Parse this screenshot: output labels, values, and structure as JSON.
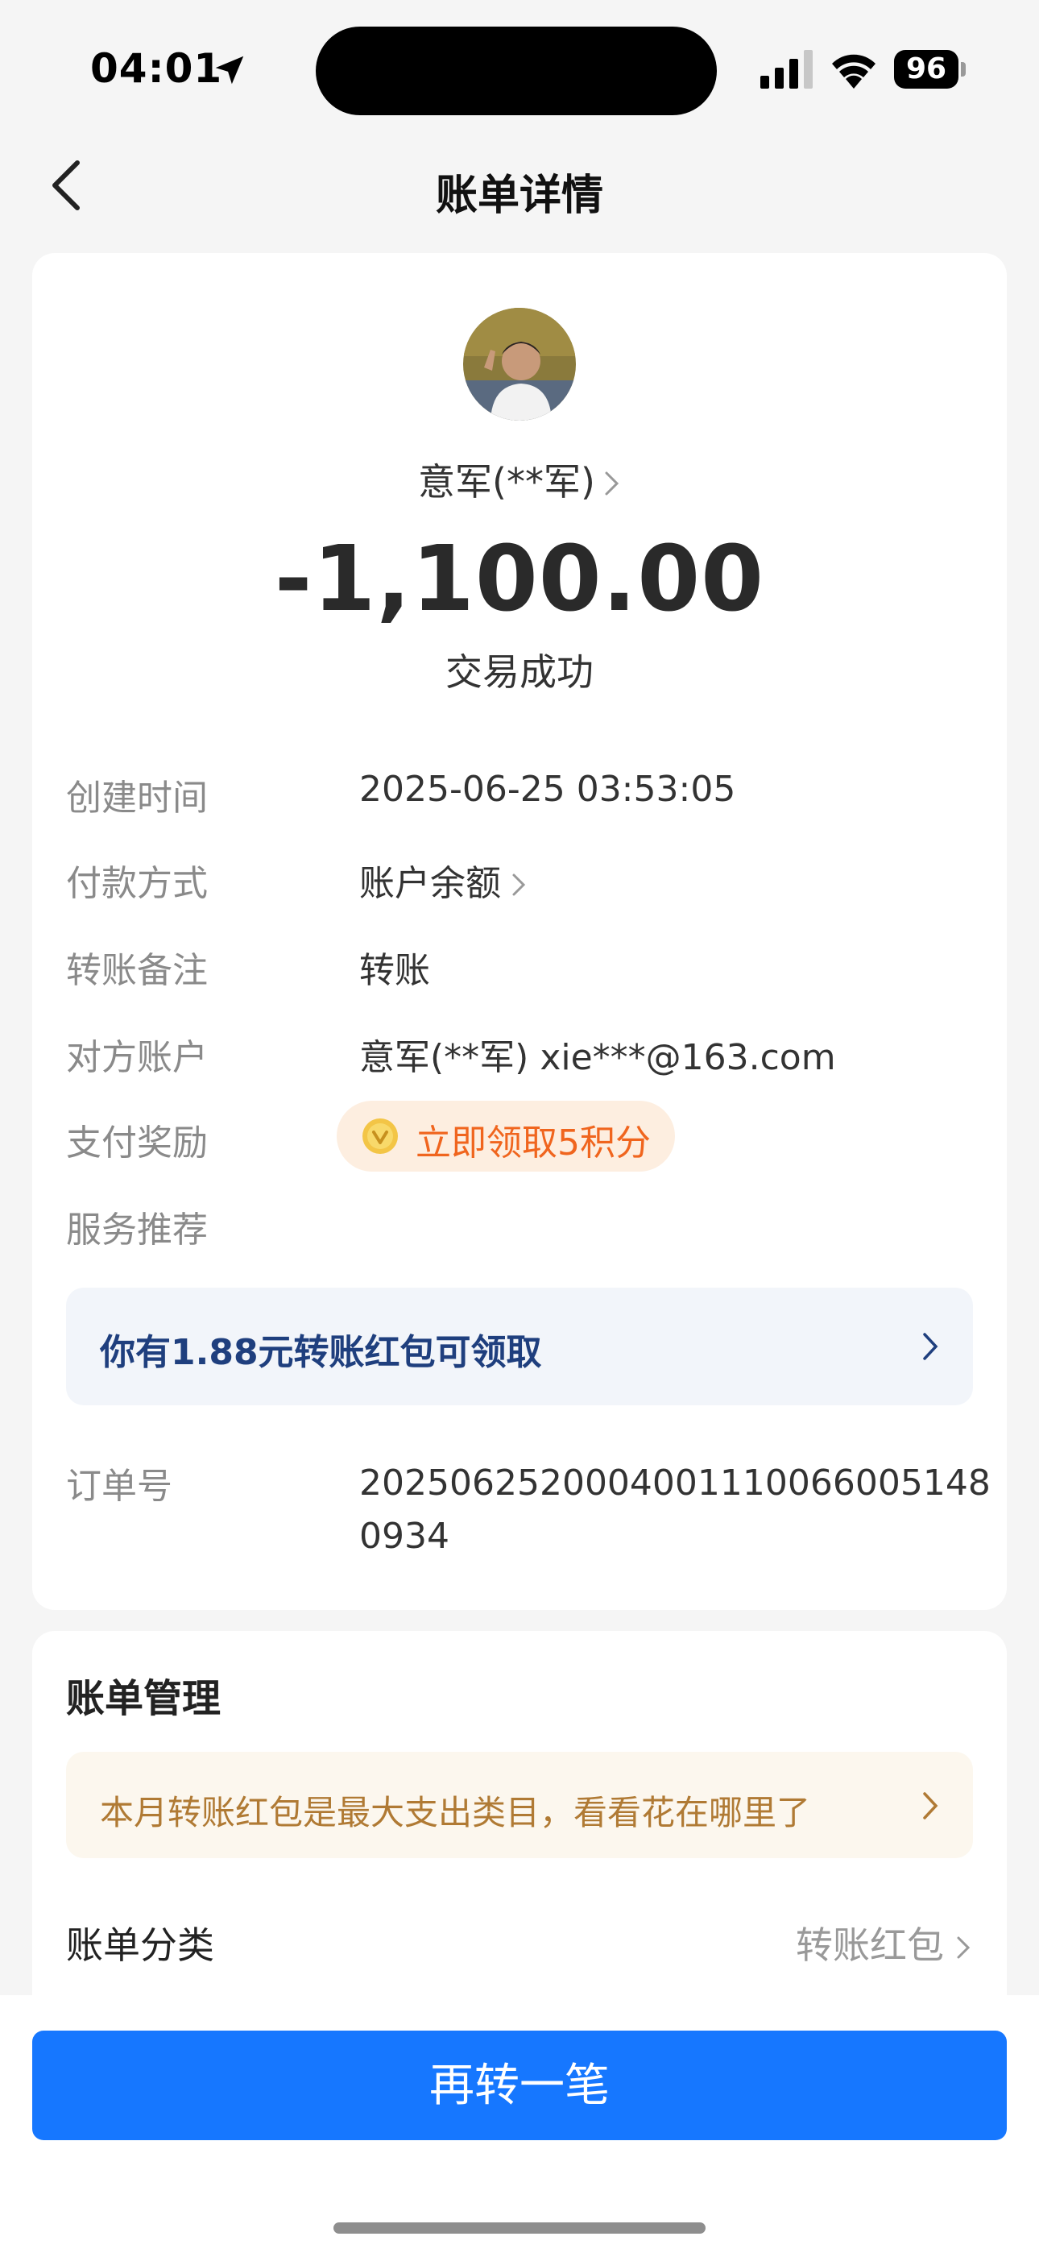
{
  "status_bar": {
    "time": "04:01",
    "battery": "96"
  },
  "nav": {
    "title": "账单详情"
  },
  "header": {
    "counterparty": "意军(**军)",
    "amount": "-1,100.00",
    "status": "交易成功"
  },
  "details": [
    {
      "label": "创建时间",
      "value": "2025-06-25 03:53:05"
    },
    {
      "label": "付款方式",
      "value": "账户余额"
    },
    {
      "label": "转账备注",
      "value": "转账"
    },
    {
      "label": "对方账户",
      "value": "意军(**军) xie***@163.com"
    }
  ],
  "reward": {
    "label": "支付奖励",
    "text": "立即领取5积分"
  },
  "service": {
    "label": "服务推荐",
    "banner": "你有1.88元转账红包可领取"
  },
  "order": {
    "label": "订单号",
    "value": "20250625200040011100660051480934"
  },
  "manage": {
    "title": "账单管理",
    "tip": "本月转账红包是最大支出类目，看看花在哪里了",
    "category_label": "账单分类",
    "category_value": "转账红包"
  },
  "actions": {
    "primary": "再转一笔"
  },
  "colors": {
    "primary": "#1677ff",
    "reward": "#f0651e",
    "service_text": "#1f3f7e",
    "tip_text": "#b07a34"
  }
}
